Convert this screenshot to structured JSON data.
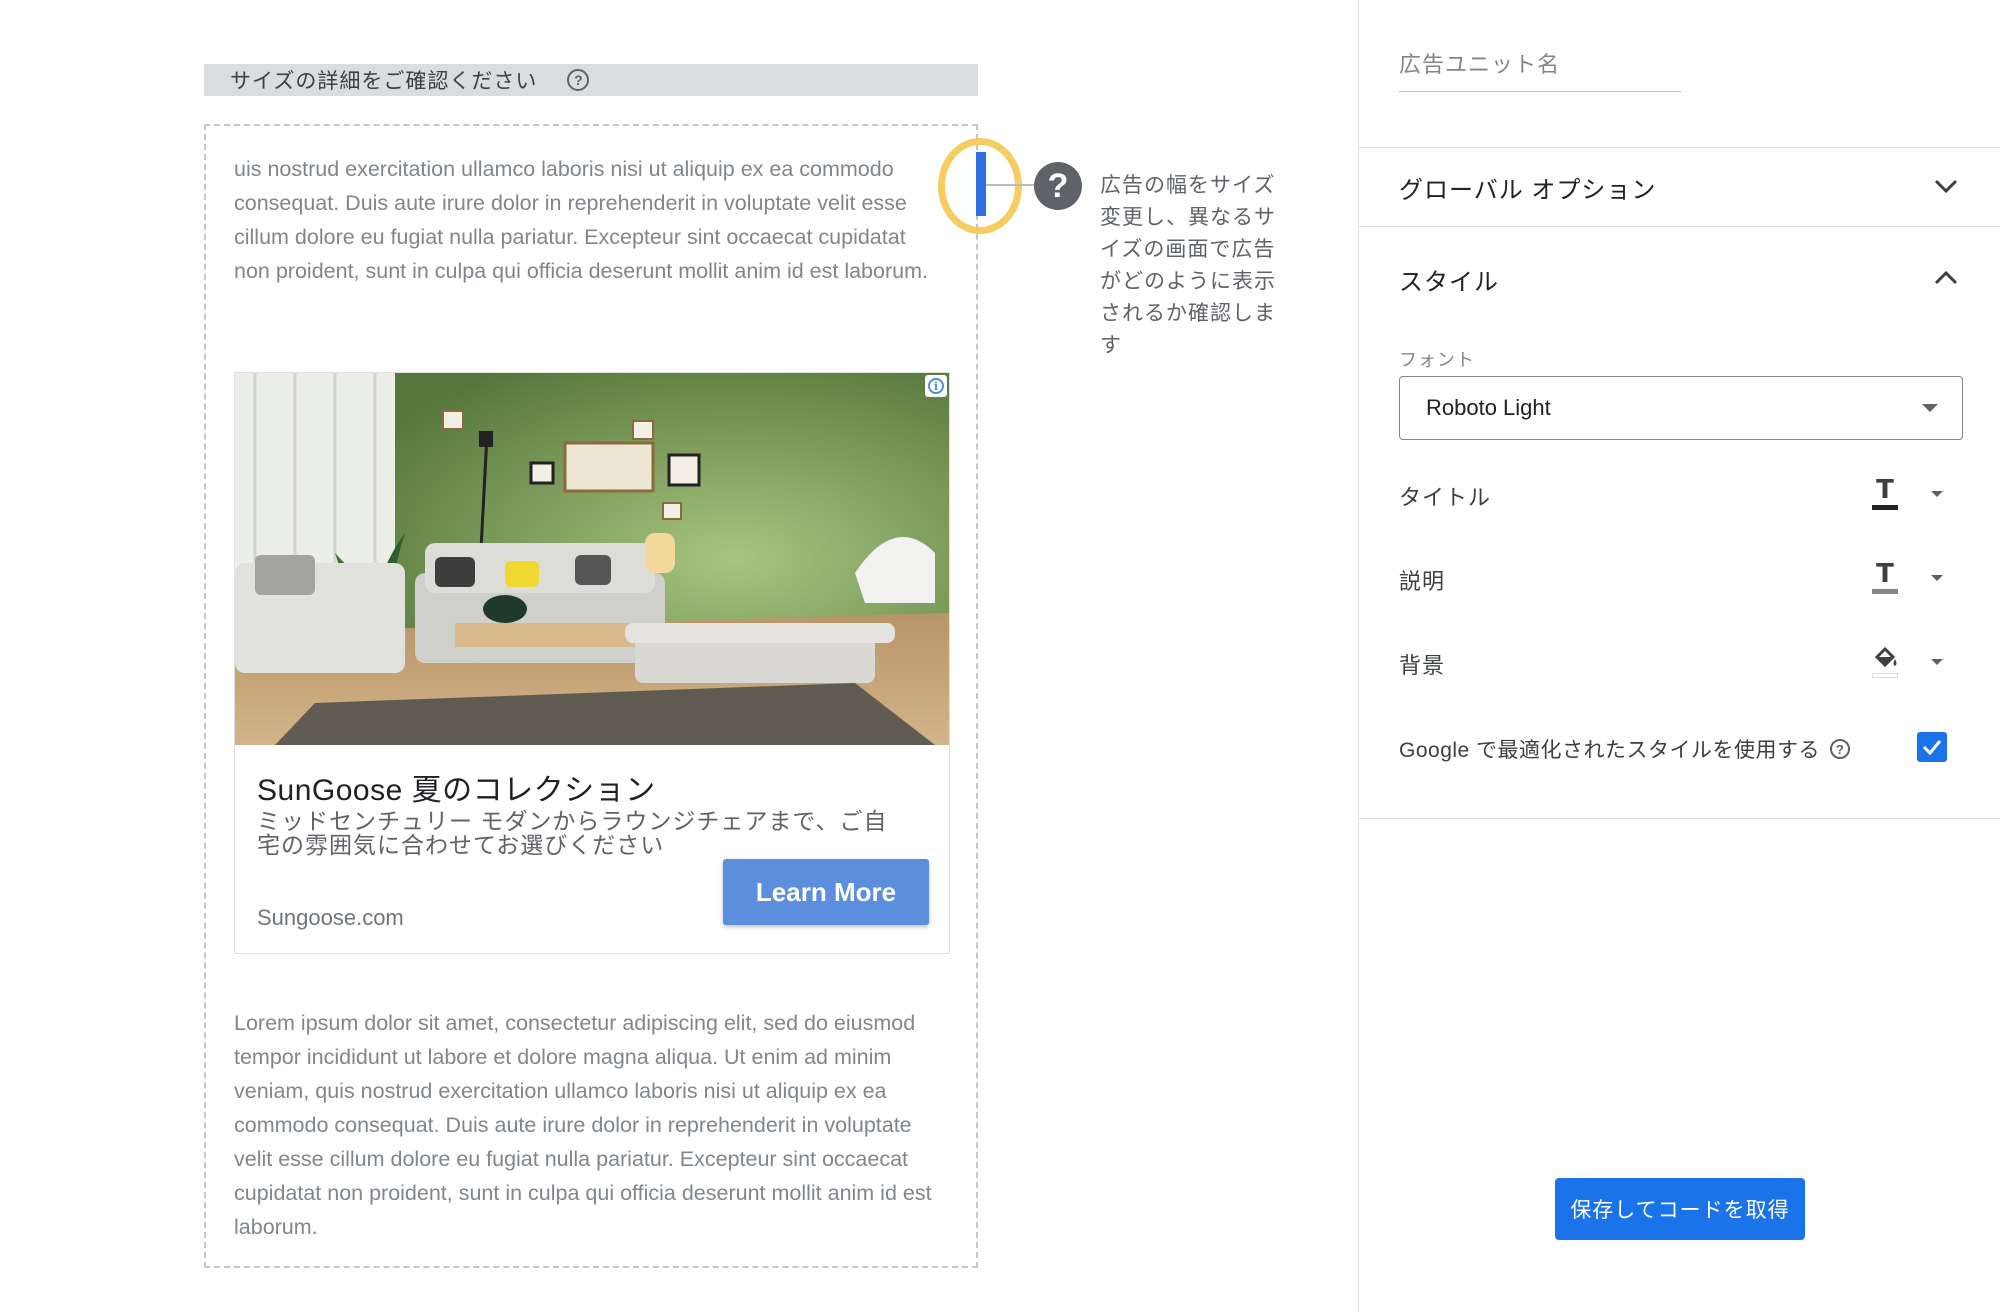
{
  "preview": {
    "size_banner_label": "サイズの詳細をご確認ください",
    "help_glyph": "?",
    "lorem_top": "uis nostrud exercitation ullamco laboris nisi ut aliquip ex ea commodo consequat. Duis aute irure dolor in reprehenderit in voluptate velit esse cillum dolore eu fugiat nulla pariatur. Excepteur sint occaecat cupidatat non proident, sunt in culpa qui officia deserunt mollit anim id est laborum.",
    "lorem_bottom": "Lorem ipsum dolor sit amet, consectetur adipiscing elit, sed do eiusmod tempor incididunt ut labore et dolore magna aliqua. Ut enim ad minim veniam, quis nostrud exercitation ullamco laboris nisi ut aliquip ex ea commodo consequat. Duis aute irure dolor in reprehenderit in voluptate velit esse cillum dolore eu fugiat nulla pariatur. Excepteur sint occaecat cupidatat non proident, sunt in culpa qui officia deserunt mollit anim id est laborum.",
    "tip_glyph": "?",
    "tip_text": "広告の幅をサイズ変更し、異なるサイズの画面で広告がどのように表示されるか確認します"
  },
  "ad": {
    "adchoices_glyph": "i",
    "headline": "SunGoose 夏のコレクション",
    "description": "ミッドセンチュリー モダンからラウンジチェアまで、ご自宅の雰囲気に合わせてお選びください",
    "domain": "Sungoose.com",
    "cta_label": "Learn More"
  },
  "panel": {
    "unit_name_placeholder": "広告ユニット名",
    "global_options_label": "グローバル オプション",
    "style_label": "スタイル",
    "font_field_label": "フォント",
    "font_value": "Roboto Light",
    "title_row_label": "タイトル",
    "description_row_label": "説明",
    "background_row_label": "背景",
    "text_glyph": "T",
    "google_optimized_label": "Google で最適化されたスタイルを使用する",
    "help_glyph": "?",
    "save_button_label": "保存してコードを取得"
  },
  "colors": {
    "accent": "#1a73e8",
    "cta": "#5b8edc",
    "highlight_ring": "#f6c344",
    "title_swatch": "#202124",
    "description_swatch": "#80868b"
  }
}
